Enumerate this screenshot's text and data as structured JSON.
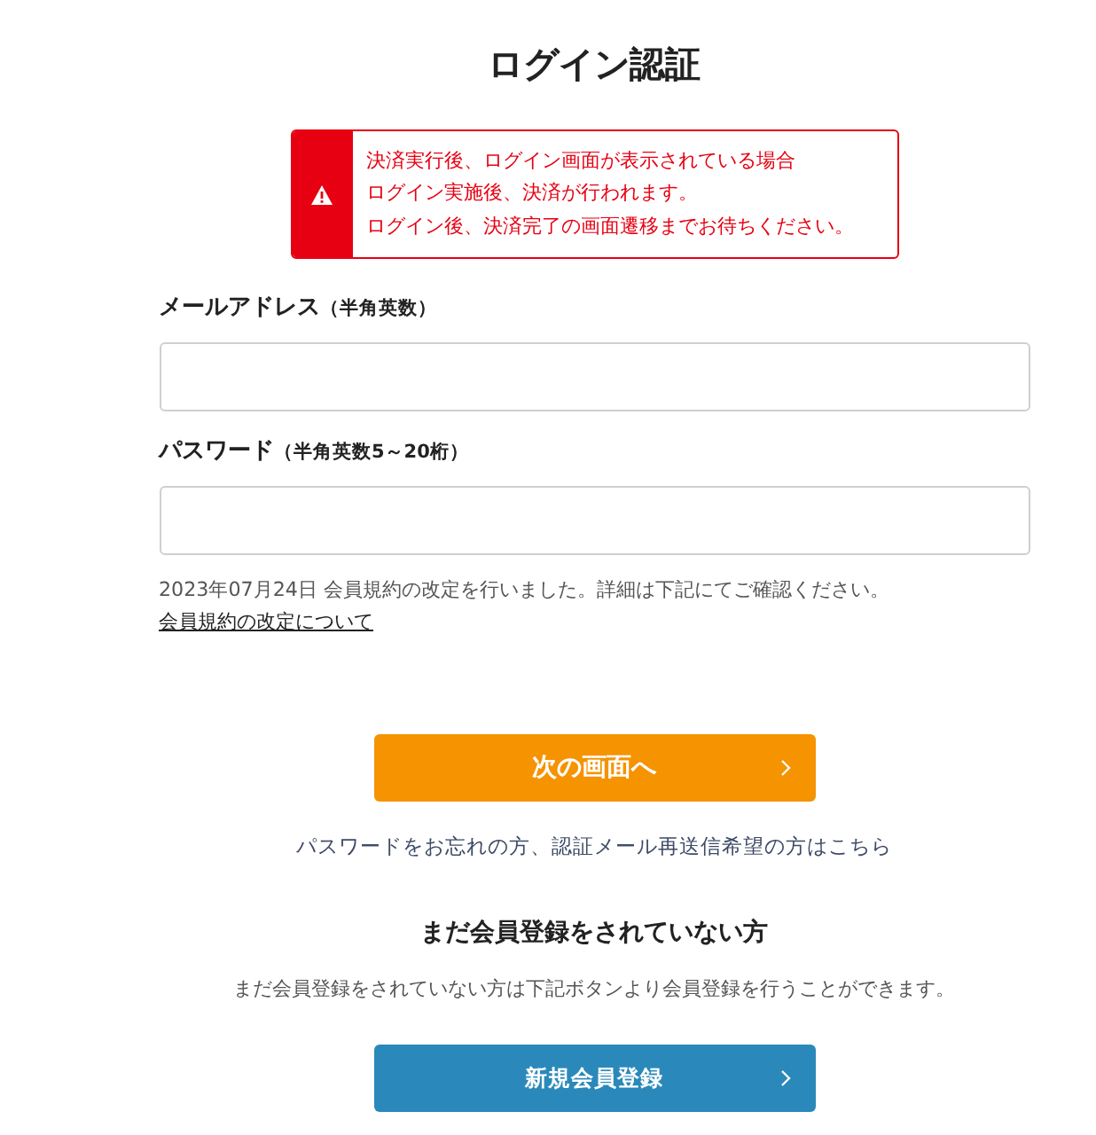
{
  "title": "ログイン認証",
  "alert": {
    "lines": [
      "決済実行後、ログイン画面が表示されている場合",
      "ログイン実施後、決済が行われます。",
      "ログイン後、決済完了の画面遷移までお待ちください。"
    ]
  },
  "fields": [
    {
      "label": "メールアドレス",
      "note": "（半角英数）"
    },
    {
      "label": "パスワード",
      "note": "（半角英数5～20桁）"
    }
  ],
  "notice": {
    "text": "2023年07月24日 会員規約の改定を行いました。詳細は下記にてご確認ください。",
    "link": "会員規約の改定について"
  },
  "submit_button": {
    "label": "次の画面へ"
  },
  "forgot_link": "パスワードをお忘れの方、認証メール再送信希望の方はこちら",
  "register": {
    "heading": "まだ会員登録をされていない方",
    "text": "まだ会員登録をされていない方は下記ボタンより会員登録を行うことができます。",
    "button": "新規会員登録"
  }
}
